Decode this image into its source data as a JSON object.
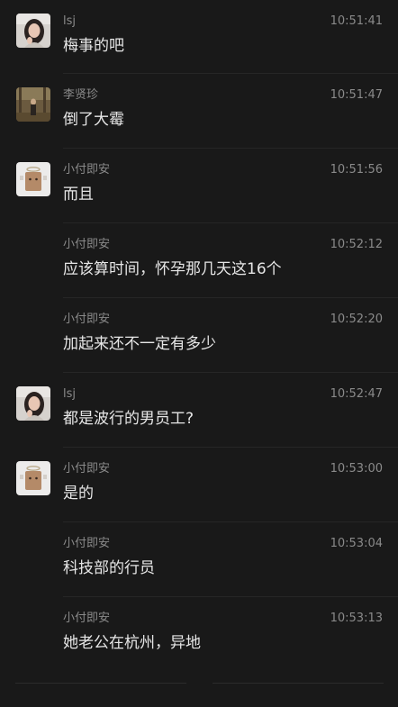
{
  "messages": [
    {
      "sender": "lsj",
      "time": "10:51:41",
      "text": "梅事的吧",
      "avatar": "avatar-lsj"
    },
    {
      "sender": "李贤珍",
      "time": "10:51:47",
      "text": "倒了大霉",
      "avatar": "avatar-lixianzhen"
    },
    {
      "sender": "小付即安",
      "time": "10:51:56",
      "text": "而且",
      "avatar": "avatar-xiaofu"
    },
    {
      "sender": "小付即安",
      "time": "10:52:12",
      "text": "应该算时间，怀孕那几天这16个",
      "avatar": ""
    },
    {
      "sender": "小付即安",
      "time": "10:52:20",
      "text": "加起来还不一定有多少",
      "avatar": ""
    },
    {
      "sender": "lsj",
      "time": "10:52:47",
      "text": "都是波行的男员工?",
      "avatar": "avatar-lsj"
    },
    {
      "sender": "小付即安",
      "time": "10:53:00",
      "text": "是的",
      "avatar": "avatar-xiaofu"
    },
    {
      "sender": "小付即安",
      "time": "10:53:04",
      "text": "科技部的行员",
      "avatar": ""
    },
    {
      "sender": "小付即安",
      "time": "10:53:13",
      "text": "她老公在杭州，异地",
      "avatar": ""
    }
  ],
  "colors": {
    "background": "#191919",
    "meta_text": "#8a8a8a",
    "message_text": "#e6e6e6",
    "divider": "#262626"
  }
}
